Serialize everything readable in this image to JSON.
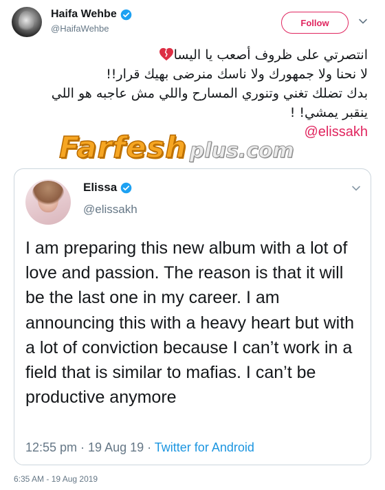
{
  "author": {
    "display_name": "Haifa Wehbe",
    "handle": "@HaifaWehbe",
    "follow_label": "Follow"
  },
  "tweet": {
    "line1": "انتصرتي على ظروف أصعب يا اليسا",
    "line2": "لا نحنا ولا جمهورك ولا ناسك منرضى بهيك قرار!!",
    "line3": "بدك تضلك تغني وتنوري المسارح  واللي مش عاجبه هو اللي",
    "line4": "ينقبر يمشي! !",
    "mention": "@elissakh",
    "emoji_icon": "broken-heart-icon"
  },
  "watermark": {
    "farfesh": "Farfesh",
    "plus": "plus.com"
  },
  "quoted_tweet": {
    "display_name": "Elissa",
    "handle": "@elissakh",
    "body": "I am preparing this new album with a lot of love and passion. The reason is that it will be the last one in my career. I am announcing this with a heavy heart but with a lot of conviction because I can’t work in a field that is similar to mafias. I can’t be productive anymore",
    "time": "12:55 pm · 19 Aug 19 · ",
    "source": "Twitter for Android"
  },
  "timestamp": "6:35 AM - 19 Aug 2019",
  "colors": {
    "accent": "#e0245e",
    "link": "#1b95e0",
    "verified": "#1da1f2",
    "muted": "#657786"
  }
}
